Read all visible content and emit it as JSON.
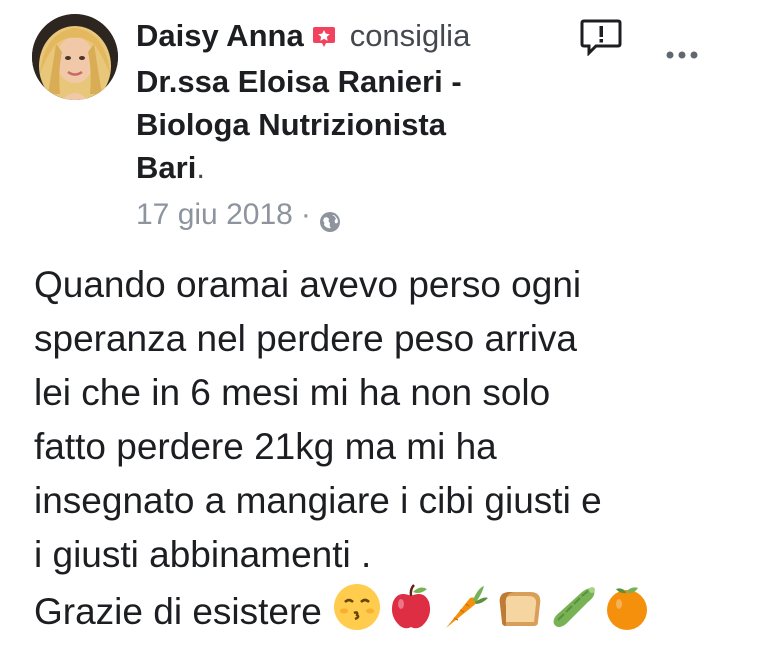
{
  "post": {
    "author": "Daisy Anna",
    "action": "consiglia",
    "page_line1": "Dr.ssa Eloisa Ranieri -",
    "page_line2": "Biologa Nutrizionista",
    "page_line3": "Bari",
    "page_suffix": ".",
    "date": "17 giu 2018",
    "separator": "·",
    "privacy_icon": "globe-icon",
    "recommend_icon": "recommend-badge-icon",
    "report_icon": "report-icon",
    "more_icon": "more-options-icon",
    "body": "Quando oramai avevo perso ogni\nsperanza nel perdere peso arriva\nlei che in 6 mesi mi ha non solo\nfatto perdere 21kg ma mi ha\ninsegnato a mangiare i cibi giusti e\ni giusti abbinamenti .",
    "closing": "Grazie di esistere",
    "emojis": [
      "kissing-face",
      "apple",
      "carrot",
      "bread",
      "cucumber",
      "tangerine"
    ],
    "colors": {
      "recommend_badge": "#f3425f",
      "meta_gray": "#8d949e",
      "text": "#1c1e21"
    }
  }
}
